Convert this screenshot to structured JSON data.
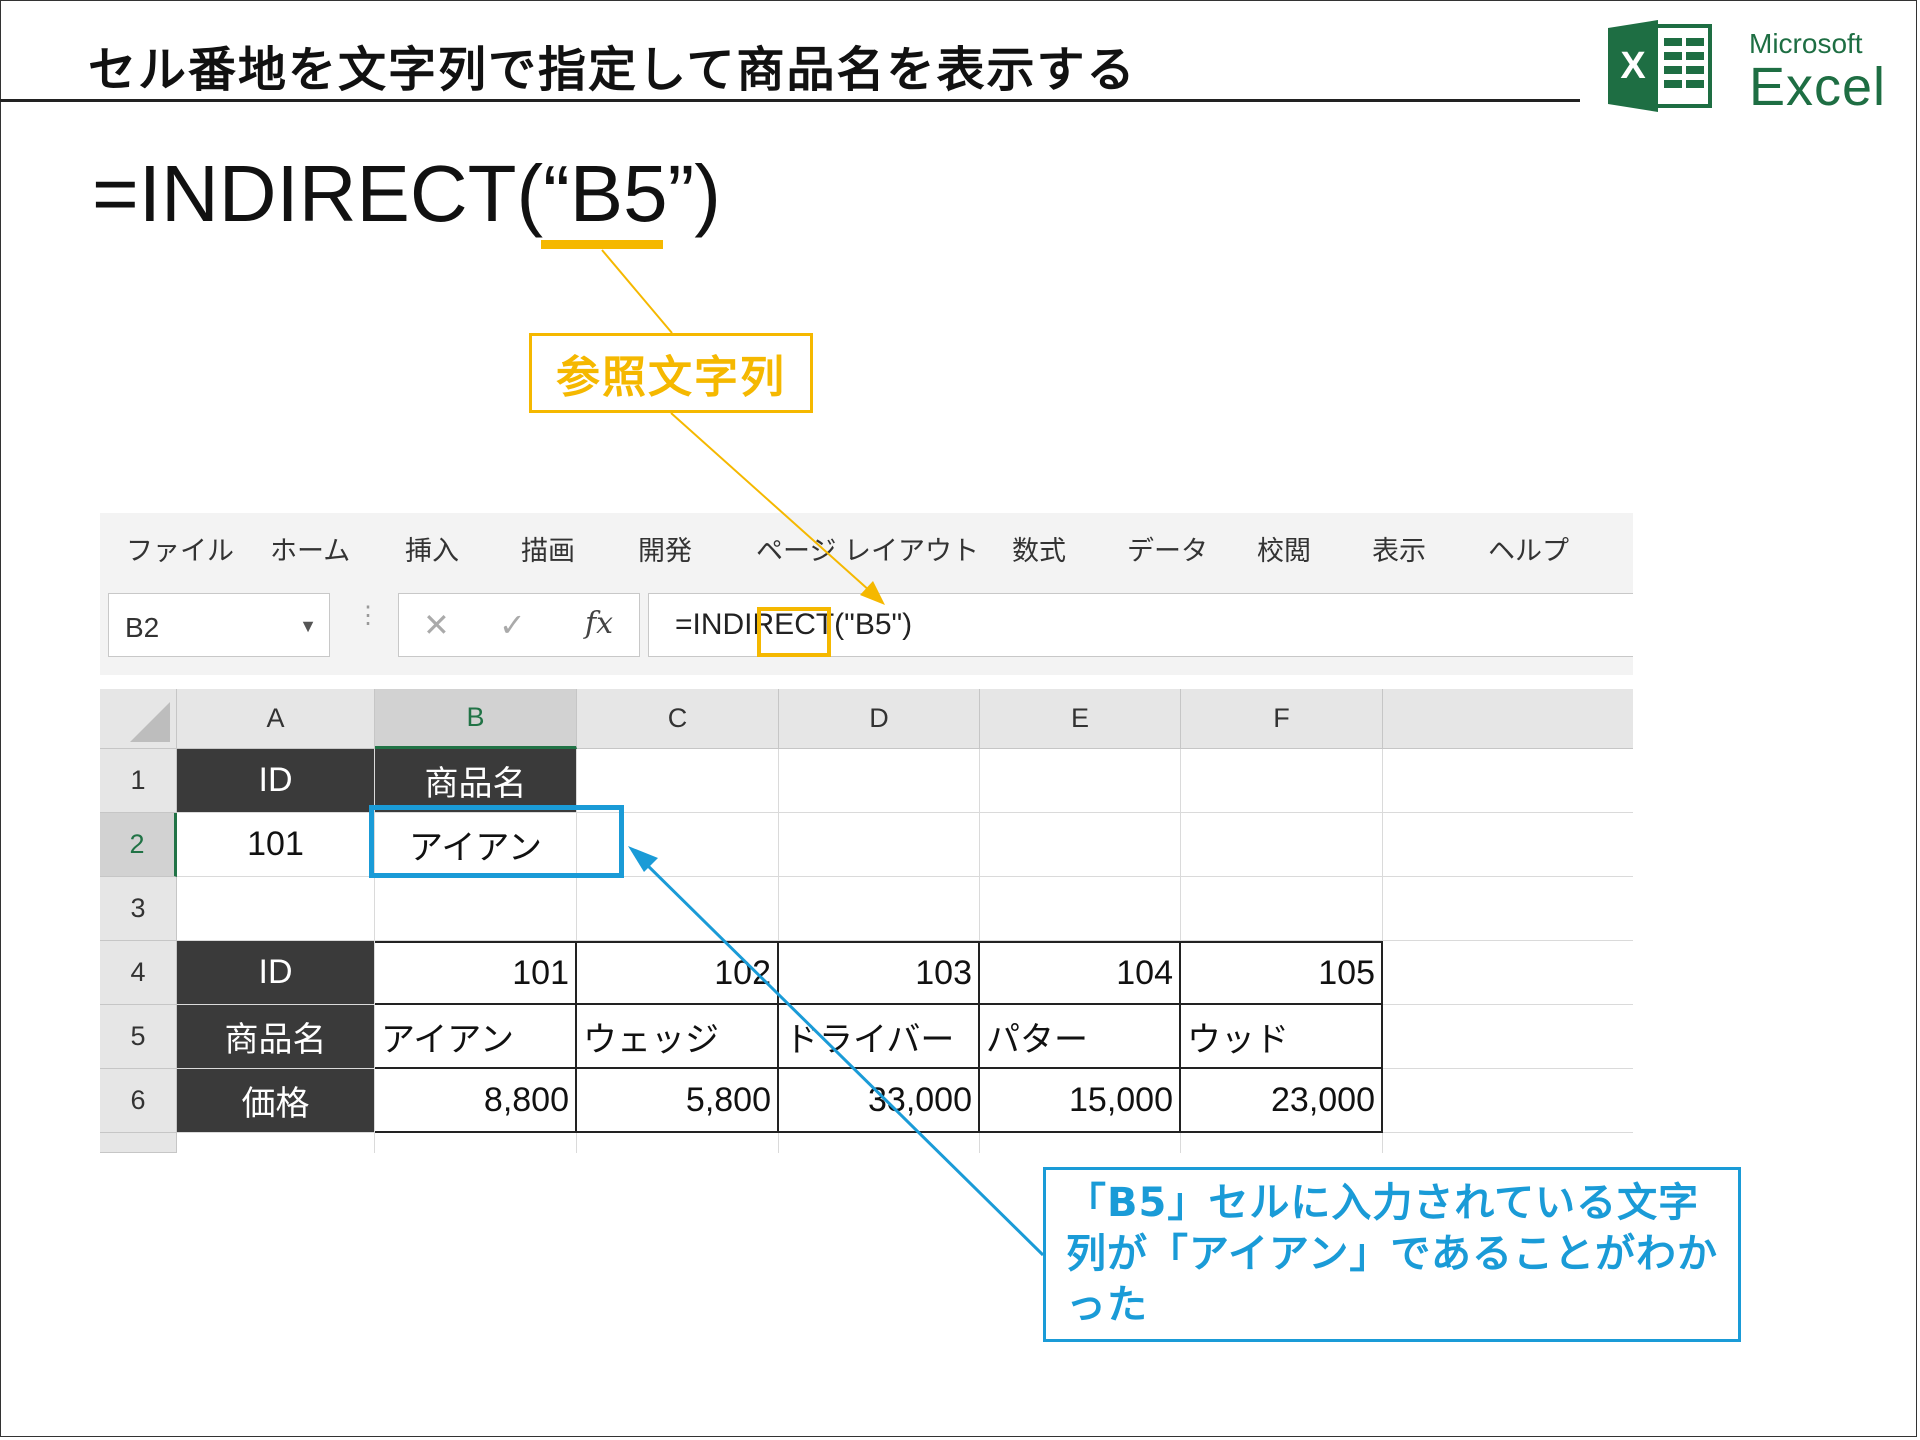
{
  "slide": {
    "title": "セル番地を文字列で指定して商品名を表示する",
    "formula": "=INDIRECT(“B5”)",
    "ref_callout": "参照文字列",
    "result_callout": "「B5」セルに入力されている文字列が「アイアン」であることがわかった"
  },
  "logo": {
    "brand": "Microsoft",
    "product": "Excel",
    "icon_letter": "X"
  },
  "ribbon": {
    "tabs": [
      "ファイル",
      "ホーム",
      "挿入",
      "描画",
      "開発",
      "ページ レイアウト",
      "数式",
      "データ",
      "校閲",
      "表示",
      "ヘルプ"
    ]
  },
  "formula_bar": {
    "name_box": "B2",
    "cancel_icon": "✕",
    "enter_icon": "✓",
    "fx_label": "fx",
    "formula": "=INDIRECT(\"B5\")"
  },
  "sheet": {
    "columns": [
      "A",
      "B",
      "C",
      "D",
      "E",
      "F"
    ],
    "rows": [
      "1",
      "2",
      "3",
      "4",
      "5",
      "6"
    ],
    "selected_cell": "B2",
    "cells": {
      "A1": "ID",
      "B1": "商品名",
      "A2": "101",
      "B2": "アイアン",
      "A4": "ID",
      "B4": "101",
      "C4": "102",
      "D4": "103",
      "E4": "104",
      "F4": "105",
      "A5": "商品名",
      "B5": "アイアン",
      "C5": "ウェッジ",
      "D5": "ドライバー",
      "E5": "パター",
      "F5": "ウッド",
      "A6": "価格",
      "B6": "8,800",
      "C6": "5,800",
      "D6": "33,000",
      "E6": "15,000",
      "F6": "23,000"
    }
  },
  "colors": {
    "accent_yellow": "#f5b800",
    "accent_blue": "#1a9bd7",
    "excel_green": "#217346",
    "header_dark": "#3a3a3a"
  }
}
